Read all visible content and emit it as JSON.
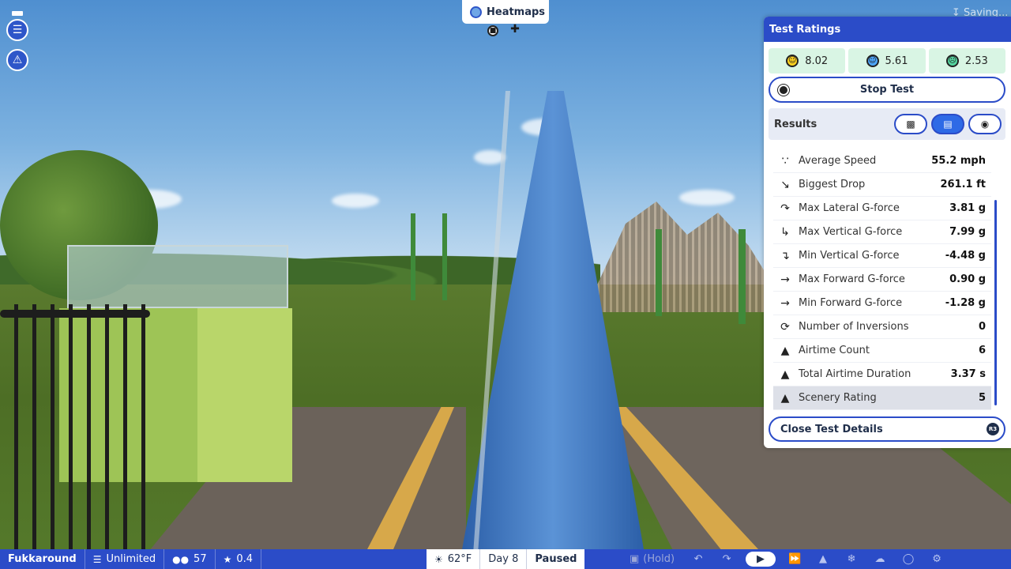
{
  "hud": {
    "heatmaps_label": "Heatmaps",
    "saving_label": "Saving..."
  },
  "panel": {
    "title": "Test Ratings",
    "ratings": [
      {
        "name": "excitement",
        "value": "8.02"
      },
      {
        "name": "intensity",
        "value": "5.61"
      },
      {
        "name": "nausea",
        "value": "2.53"
      }
    ],
    "stop_test_label": "Stop Test",
    "results_label": "Results",
    "stats": [
      {
        "label": "Average Speed",
        "value": "55.2 mph",
        "icon": "speed-icon"
      },
      {
        "label": "Biggest Drop",
        "value": "261.1 ft",
        "icon": "drop-icon"
      },
      {
        "label": "Max Lateral G-force",
        "value": "3.81 g",
        "icon": "lateral-arrow-icon"
      },
      {
        "label": "Max Vertical G-force",
        "value": "7.99 g",
        "icon": "vertical-arrow-icon"
      },
      {
        "label": "Min Vertical G-force",
        "value": "-4.48 g",
        "icon": "vertical-curve-icon"
      },
      {
        "label": "Max Forward G-force",
        "value": "0.90 g",
        "icon": "forward-arrow-icon"
      },
      {
        "label": "Min Forward G-force",
        "value": "-1.28 g",
        "icon": "forward-arrow-icon"
      },
      {
        "label": "Number of Inversions",
        "value": "0",
        "icon": "loop-icon"
      },
      {
        "label": "Airtime Count",
        "value": "6",
        "icon": "airtime-icon"
      },
      {
        "label": "Total Airtime Duration",
        "value": "3.37 s",
        "icon": "airtime-icon"
      },
      {
        "label": "Scenery Rating",
        "value": "5",
        "icon": "tree-icon"
      }
    ],
    "close_details_label": "Close Test Details"
  },
  "bottom": {
    "park_name": "Fukkaround",
    "money": "Unlimited",
    "guests": "57",
    "rating": "0.4",
    "temperature": "62°F",
    "day": "Day 8",
    "status": "Paused",
    "hold_label": "(Hold)"
  }
}
